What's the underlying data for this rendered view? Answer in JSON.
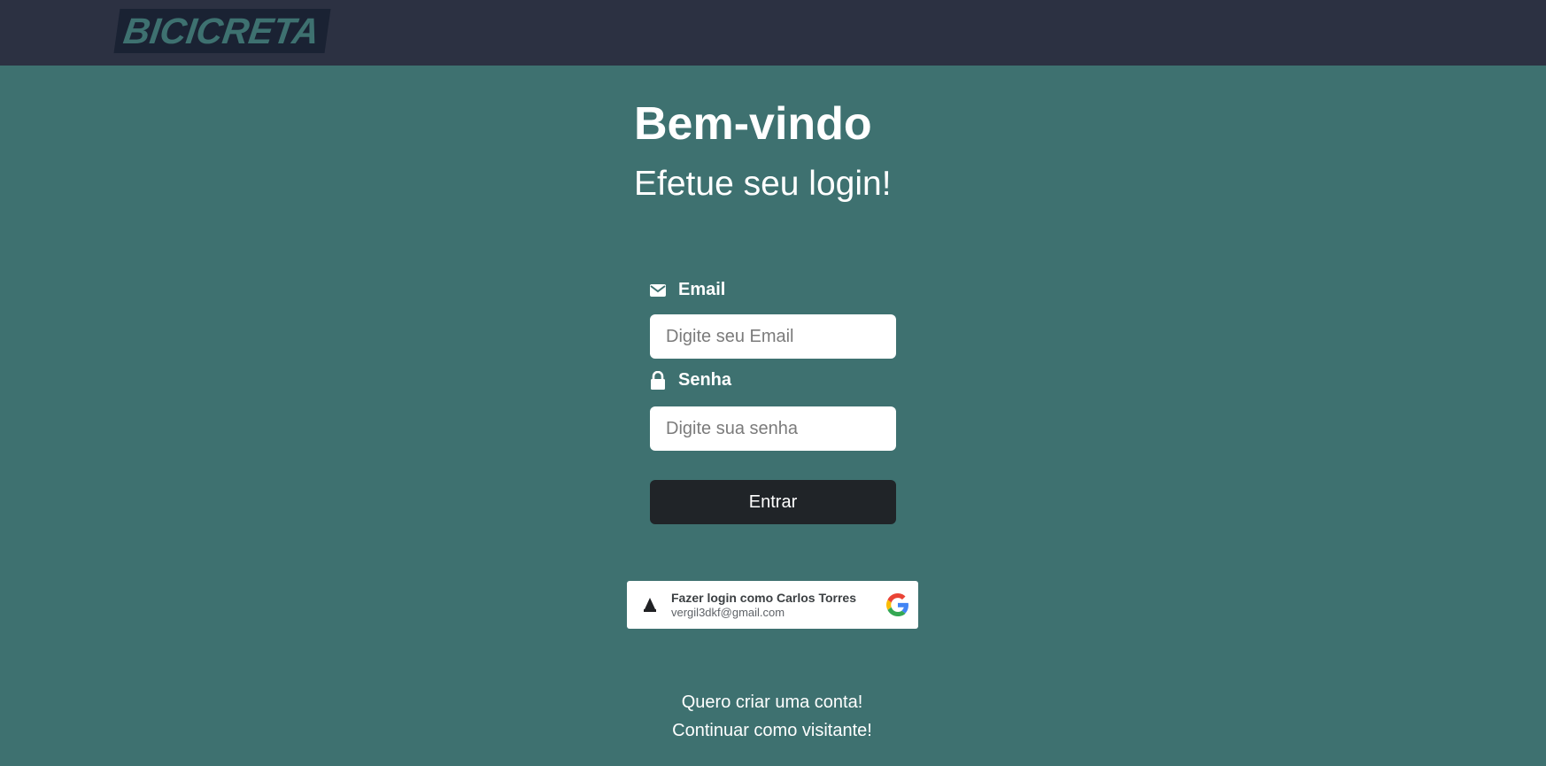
{
  "header": {
    "logo_text": "BICICRETA"
  },
  "welcome": {
    "title": "Bem-vindo",
    "subtitle": "Efetue seu login!"
  },
  "form": {
    "email_label": "Email",
    "email_placeholder": "Digite seu Email",
    "email_value": "",
    "email_icon": "envelope-icon",
    "password_label": "Senha",
    "password_placeholder": "Digite sua senha",
    "password_value": "",
    "password_icon": "lock-icon",
    "submit_label": "Entrar"
  },
  "google_signin": {
    "name_line": "Fazer login como Carlos Torres",
    "email_line": "vergil3dkf@gmail.com",
    "avatar_icon": "user-avatar-icon",
    "logo_icon": "google-logo-icon"
  },
  "links": {
    "create_account": "Quero criar uma conta!",
    "continue_guest": "Continuar como visitante!"
  },
  "colors": {
    "background": "#3e7170",
    "header": "#2c3142",
    "button": "#202428"
  }
}
